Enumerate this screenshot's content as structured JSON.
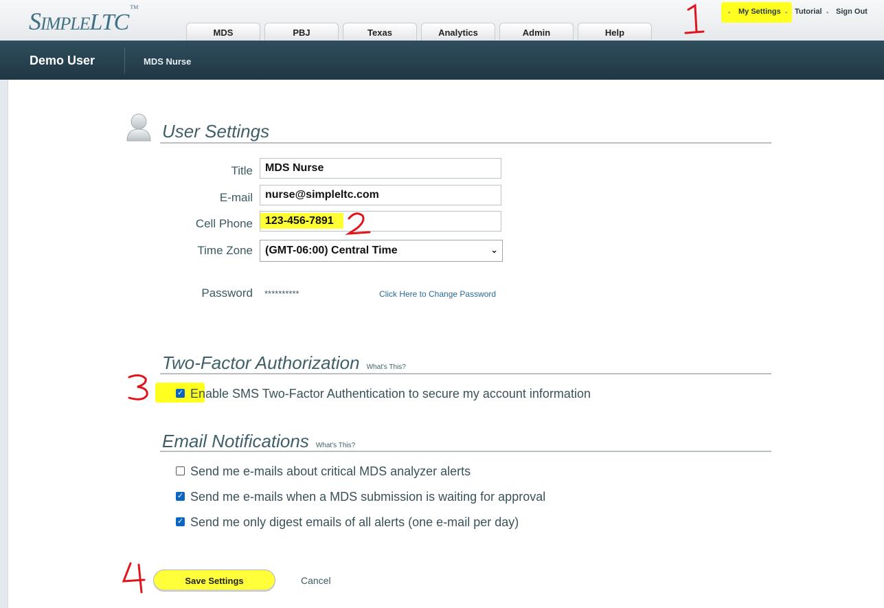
{
  "app": {
    "logo_simple": "SIMPLE",
    "logo_ltc": "LTC",
    "logo_tm": "TM"
  },
  "tabs": [
    "MDS",
    "PBJ",
    "Texas",
    "Analytics",
    "Admin",
    "Help"
  ],
  "toplinks": {
    "my_settings": "My Settings",
    "tutorial": "Tutorial",
    "sign_out": "Sign Out"
  },
  "nav": {
    "user": "Demo User",
    "role": "MDS Nurse"
  },
  "user_settings": {
    "title": "User Settings",
    "title_label": "Title",
    "title_value": "MDS Nurse",
    "email_label": "E-mail",
    "email_value": "nurse@simpleltc.com",
    "phone_label": "Cell Phone",
    "phone_value": "123-456-7891",
    "tz_label": "Time Zone",
    "tz_value": "(GMT-06:00) Central Time",
    "password_label": "Password",
    "password_value": "**********",
    "change_password": "Click Here to Change Password"
  },
  "two_factor": {
    "title": "Two-Factor Authorization",
    "whats_this": "What's This?",
    "option": "Enable SMS Two-Factor Authentication to secure my account information",
    "checked": true
  },
  "email_notifications": {
    "title": "Email Notifications",
    "whats_this": "What's This?",
    "options": [
      {
        "label": "Send me e-mails about critical MDS analyzer alerts",
        "checked": false
      },
      {
        "label": "Send me e-mails when a MDS submission is waiting for approval",
        "checked": true
      },
      {
        "label": "Send me only digest emails of all alerts (one e-mail per day)",
        "checked": true
      }
    ]
  },
  "actions": {
    "save": "Save Settings",
    "cancel": "Cancel"
  },
  "annotations": [
    "1",
    "2",
    "3",
    "4"
  ],
  "colors": {
    "highlight": "#ffff33",
    "annotation": "#e0141a",
    "nav_bg": "#2f4e5e",
    "checkbox": "#0a66c2"
  }
}
